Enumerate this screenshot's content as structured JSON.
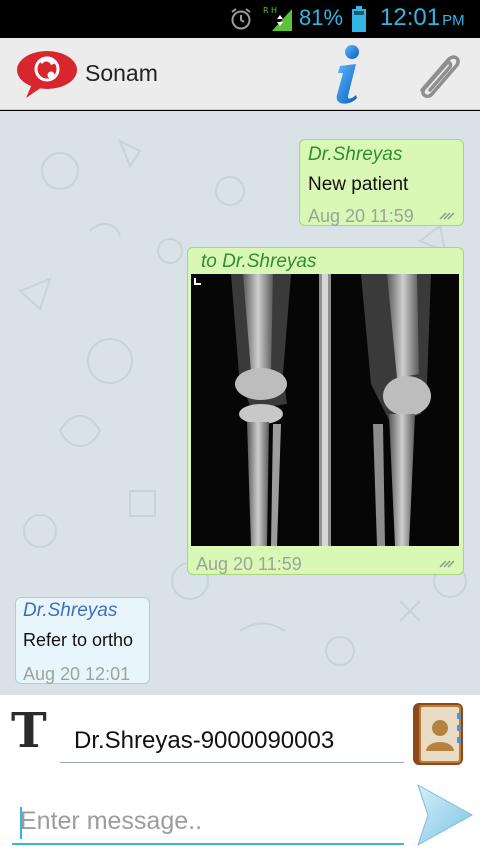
{
  "status_bar": {
    "battery_percent": "81%",
    "time": "12:01",
    "ampm": "PM",
    "signal_label": "R H",
    "icons": [
      "alarm-clock-icon",
      "signal-icon",
      "battery-icon"
    ]
  },
  "header": {
    "contact_name": "Sonam",
    "icons": [
      "app-logo-icon",
      "info-icon",
      "attach-paperclip-icon"
    ]
  },
  "messages": [
    {
      "direction": "outgoing",
      "sender": "Dr.Shreyas",
      "text": "New patient",
      "timestamp": "Aug 20 11:59"
    },
    {
      "direction": "outgoing",
      "sender": "to Dr.Shreyas",
      "attachment": "x-ray image",
      "timestamp": "Aug 20 11:59"
    },
    {
      "direction": "incoming",
      "sender": "Dr.Shreyas",
      "text": "Refer to ortho",
      "timestamp": "Aug 20 12:01"
    }
  ],
  "compose": {
    "recipient": "Dr.Shreyas-9000090003",
    "message_placeholder": "Enter message..",
    "message_value": "",
    "icons": [
      "text-format-icon",
      "contacts-book-icon",
      "send-arrow-icon"
    ]
  },
  "colors": {
    "accent": "#33b5e5",
    "outgoing_bubble": "#d9f7b5",
    "incoming_bubble": "#e8f6fc",
    "chat_background": "#d8e2e7",
    "brand_red": "#d8262e"
  }
}
